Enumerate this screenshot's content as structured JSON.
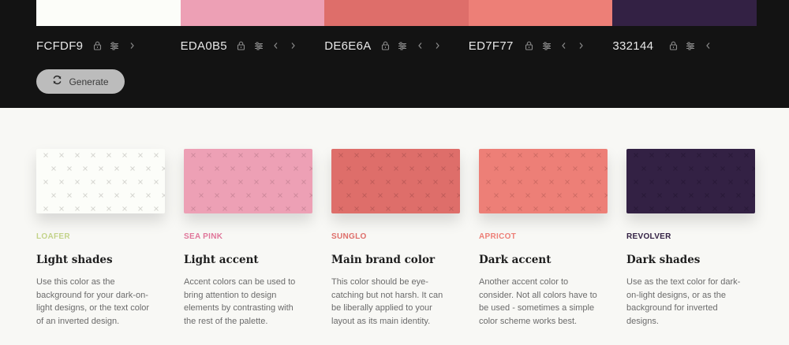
{
  "palette": [
    {
      "hex": "FCFDF9",
      "color": "#FCFDF9",
      "name": "LOAFER",
      "name_color": "#c3d38a",
      "role": "Light shades",
      "description": "Use this color as the background for your dark-on-light designs, or the text color of an inverted design.",
      "arrows": [
        "right"
      ],
      "pattern_color": "#d6d6d1"
    },
    {
      "hex": "EDA0B5",
      "color": "#EDA0B5",
      "name": "SEA PINK",
      "name_color": "#e0769a",
      "role": "Light accent",
      "description": "Accent colors can be used to bring attention to design elements by contrasting with the rest of the palette.",
      "arrows": [
        "left",
        "right"
      ],
      "pattern_color": "#cf8a9d"
    },
    {
      "hex": "DE6E6A",
      "color": "#DE6E6A",
      "name": "SUNGLO",
      "name_color": "#de6e6a",
      "role": "Main brand color",
      "description": "This color should be eye-catching but not harsh. It can be liberally applied to your layout as its main identity.",
      "arrows": [
        "left",
        "right"
      ],
      "pattern_color": "#c05d5a"
    },
    {
      "hex": "ED7F77",
      "color": "#ED7F77",
      "name": "APRICOT",
      "name_color": "#ed7f77",
      "role": "Dark accent",
      "description": "Another accent color to consider. Not all colors have to be used - sometimes a simple color scheme works best.",
      "arrows": [
        "left",
        "right"
      ],
      "pattern_color": "#cf6c65"
    },
    {
      "hex": "332144",
      "color": "#332144",
      "name": "REVOLVER",
      "name_color": "#332144",
      "role": "Dark shades",
      "description": "Use as the text color for dark-on-light designs, or as the background for inverted designs.",
      "arrows": [
        "left"
      ],
      "pattern_color": "#2a1a39"
    }
  ],
  "generate": {
    "label": "Generate",
    "icon": "refresh-icon"
  },
  "colors": {
    "topbar": "#131313",
    "page": "#f8f8f5",
    "button": "#bcbcbc"
  }
}
